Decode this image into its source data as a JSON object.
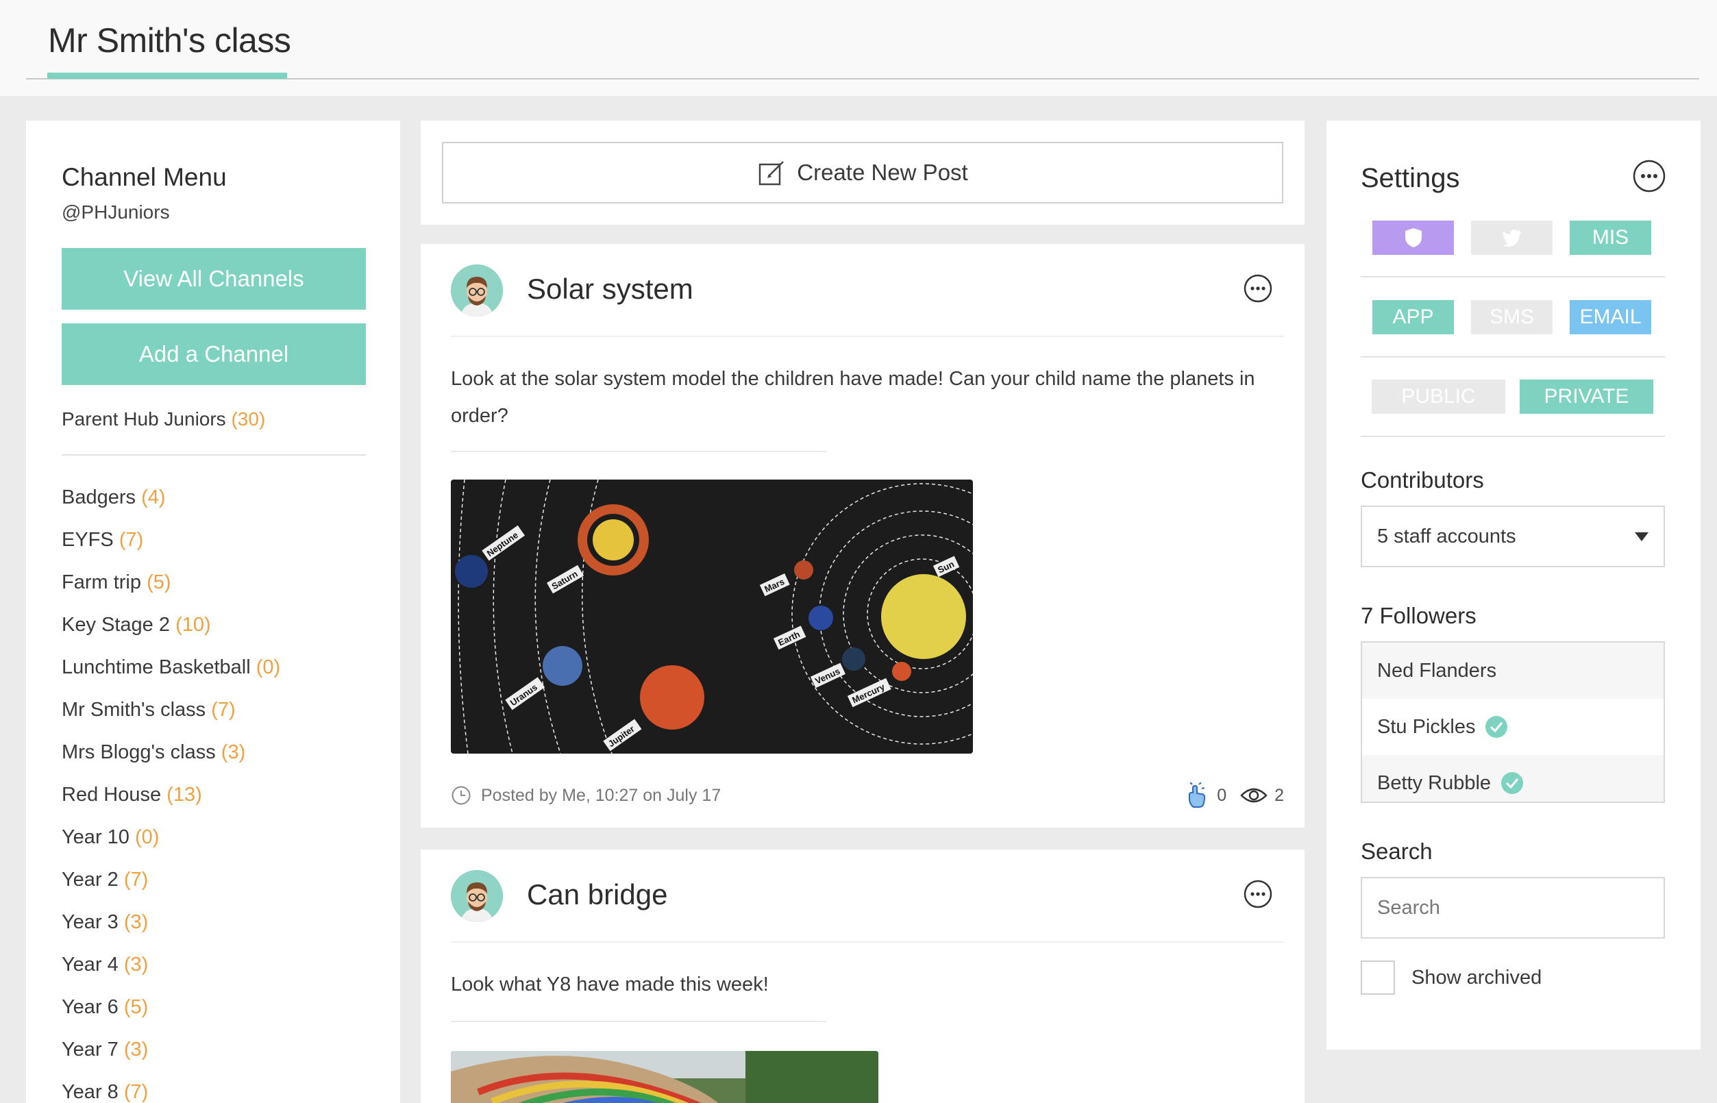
{
  "header": {
    "title": "Mr Smith's class"
  },
  "channel_menu": {
    "title": "Channel Menu",
    "handle": "@PHJuniors",
    "view_all_label": "View All Channels",
    "add_label": "Add a Channel",
    "hub": {
      "name": "Parent Hub Juniors",
      "count": "(30)"
    },
    "channels": [
      {
        "name": "Badgers",
        "count": "(4)"
      },
      {
        "name": "EYFS",
        "count": "(7)"
      },
      {
        "name": "Farm trip",
        "count": "(5)"
      },
      {
        "name": "Key Stage 2",
        "count": "(10)"
      },
      {
        "name": "Lunchtime Basketball",
        "count": "(0)"
      },
      {
        "name": "Mr Smith's class",
        "count": "(7)"
      },
      {
        "name": "Mrs Blogg's class",
        "count": "(3)"
      },
      {
        "name": "Red House",
        "count": "(13)"
      },
      {
        "name": "Year 10",
        "count": "(0)"
      },
      {
        "name": "Year 2",
        "count": "(7)"
      },
      {
        "name": "Year 3",
        "count": "(3)"
      },
      {
        "name": "Year 4",
        "count": "(3)"
      },
      {
        "name": "Year 6",
        "count": "(5)"
      },
      {
        "name": "Year 7",
        "count": "(3)"
      },
      {
        "name": "Year 8",
        "count": "(7)"
      }
    ]
  },
  "create_post": {
    "label": "Create New Post"
  },
  "posts": [
    {
      "title": "Solar system",
      "body": "Look at the solar system model the children have made! Can your child name the planets in order?",
      "footer": "Posted by Me, 10:27 on July 17",
      "likes": "0",
      "views": "2",
      "planet_labels": [
        "Neptune",
        "Saturn",
        "Uranus",
        "Jupiter",
        "Mars",
        "Earth",
        "Venus",
        "Mercury",
        "Sun"
      ]
    },
    {
      "title": "Can bridge",
      "body": "Look what Y8 have made this week!"
    }
  ],
  "settings": {
    "title": "Settings",
    "tags_row1": {
      "mis": "MIS"
    },
    "tags_row2": {
      "app": "APP",
      "sms": "SMS",
      "email": "EMAIL"
    },
    "tags_row3": {
      "public": "PUBLIC",
      "private": "PRIVATE"
    },
    "contributors_label": "Contributors",
    "contributors_value": "5 staff accounts",
    "followers_label": "7 Followers",
    "followers": [
      "Ned Flanders",
      "Stu Pickles",
      "Betty Rubble"
    ],
    "search_label": "Search",
    "search_placeholder": "Search",
    "show_archived_label": "Show archived"
  },
  "colors": {
    "accent": "#7dd3c0",
    "count": "#f0a040",
    "purple": "#b89af0",
    "blue": "#79c4f0"
  }
}
